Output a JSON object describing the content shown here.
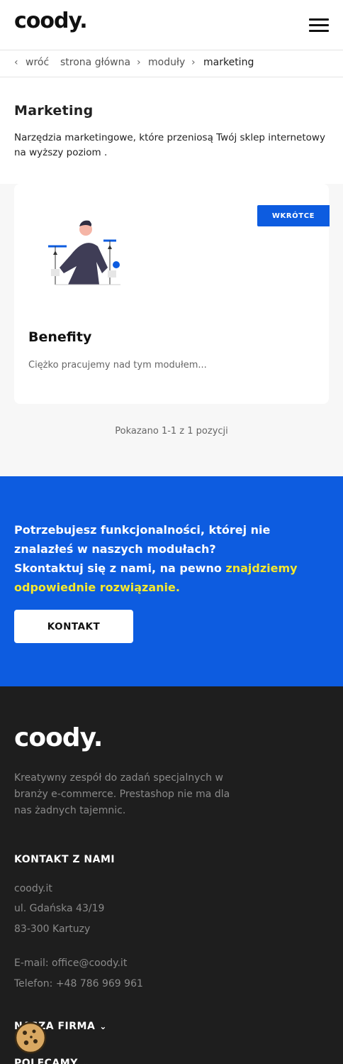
{
  "header": {
    "logo": "coody.",
    "menu_icon": "hamburger-icon"
  },
  "breadcrumb": {
    "back": "wróć",
    "items": [
      "strona główna",
      "moduły",
      "marketing"
    ]
  },
  "intro": {
    "title": "Marketing",
    "description": "Narzędzia marketingowe, które przeniosą Twój sklep internetowy na wyższy poziom ."
  },
  "module_card": {
    "badge": "WKRÓTCE",
    "title": "Benefity",
    "description": "Ciężko pracujemy nad tym modułem..."
  },
  "pagination": {
    "text": "Pokazano 1-1 z 1 pozycji"
  },
  "cta": {
    "line1": "Potrzebujesz funkcjonalności, której nie znalazłeś w naszych modułach?",
    "line2": "Skontaktuj się z nami, na pewno ",
    "highlight": "znajdziemy odpowiednie rozwiązanie.",
    "button": "KONTAKT"
  },
  "footer": {
    "logo": "coody.",
    "description": "Kreatywny zespół do zadań specjalnych w branży e-commerce. Prestashop nie ma dla nas żadnych tajemnic.",
    "contact_heading": "KONTAKT Z NAMI",
    "company": "coody.it",
    "street": "ul. Gdańska 43/19",
    "city": "83-300 Kartuzy",
    "email": "E-mail: office@coody.it",
    "phone": "Telefon: +48 786 969 961",
    "section_firm": "NASZA FIRMA",
    "section_recommend": "POLECAMY"
  },
  "colors": {
    "accent": "#0d5ce0",
    "highlight": "#f5e82e",
    "footer_bg": "#1e1e1e"
  }
}
